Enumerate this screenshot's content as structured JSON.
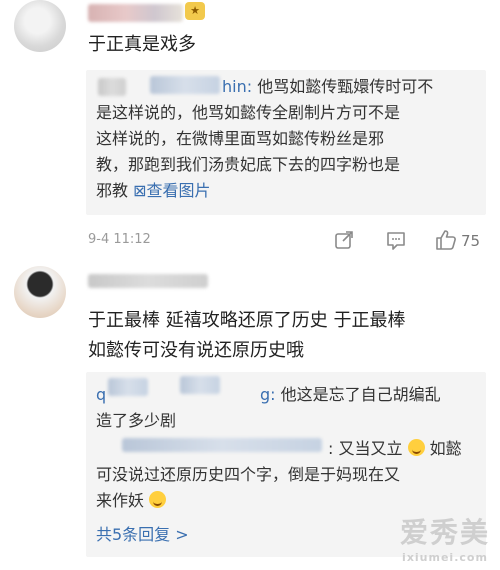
{
  "comment1": {
    "text": "于正真是戏多",
    "reply": {
      "username_suffix": "hin:",
      "line1": "他骂如懿传甄嬛传时可不",
      "line2": "是这样说的，他骂如懿传全剧制片方可不是",
      "line3": "这样说的，在微博里面骂如懿传粉丝是邪",
      "line4": "教，那跑到我们汤贵妃底下去的四字粉也是",
      "line5_text": "邪教",
      "view_image": "⊠查看图片"
    },
    "time": "9-4 11:12",
    "like_count": "75"
  },
  "comment2": {
    "line1": "于正最棒  延禧攻略还原了历史   于正最棒",
    "line2": "如懿传可没有说还原历史哦",
    "replies": [
      {
        "username_prefix": "q",
        "username_suffix": "g:",
        "line1": "他这是忘了自己胡编乱",
        "line2": "造了多少剧"
      },
      {
        "line1_text": ": 又当又立",
        "line1_after": "如懿",
        "line2": "可没说过还原历史四个字，倒是于妈现在又",
        "line3": "来作妖"
      }
    ],
    "more_replies": "共5条回复 >"
  },
  "watermark": {
    "big": "爱秀美",
    "small": "ixiumei.com"
  }
}
